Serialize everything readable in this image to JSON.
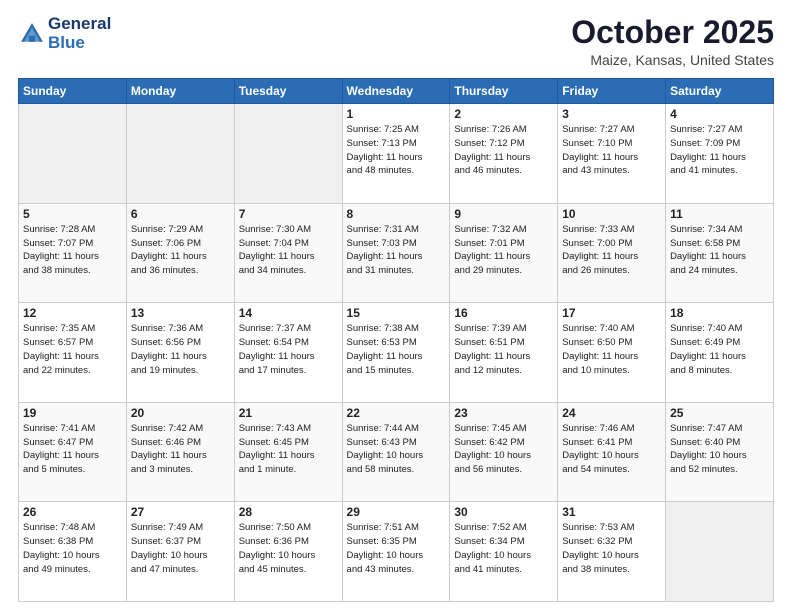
{
  "header": {
    "logo_line1": "General",
    "logo_line2": "Blue",
    "month": "October 2025",
    "location": "Maize, Kansas, United States"
  },
  "days_of_week": [
    "Sunday",
    "Monday",
    "Tuesday",
    "Wednesday",
    "Thursday",
    "Friday",
    "Saturday"
  ],
  "weeks": [
    [
      {
        "day": "",
        "info": ""
      },
      {
        "day": "",
        "info": ""
      },
      {
        "day": "",
        "info": ""
      },
      {
        "day": "1",
        "info": "Sunrise: 7:25 AM\nSunset: 7:13 PM\nDaylight: 11 hours\nand 48 minutes."
      },
      {
        "day": "2",
        "info": "Sunrise: 7:26 AM\nSunset: 7:12 PM\nDaylight: 11 hours\nand 46 minutes."
      },
      {
        "day": "3",
        "info": "Sunrise: 7:27 AM\nSunset: 7:10 PM\nDaylight: 11 hours\nand 43 minutes."
      },
      {
        "day": "4",
        "info": "Sunrise: 7:27 AM\nSunset: 7:09 PM\nDaylight: 11 hours\nand 41 minutes."
      }
    ],
    [
      {
        "day": "5",
        "info": "Sunrise: 7:28 AM\nSunset: 7:07 PM\nDaylight: 11 hours\nand 38 minutes."
      },
      {
        "day": "6",
        "info": "Sunrise: 7:29 AM\nSunset: 7:06 PM\nDaylight: 11 hours\nand 36 minutes."
      },
      {
        "day": "7",
        "info": "Sunrise: 7:30 AM\nSunset: 7:04 PM\nDaylight: 11 hours\nand 34 minutes."
      },
      {
        "day": "8",
        "info": "Sunrise: 7:31 AM\nSunset: 7:03 PM\nDaylight: 11 hours\nand 31 minutes."
      },
      {
        "day": "9",
        "info": "Sunrise: 7:32 AM\nSunset: 7:01 PM\nDaylight: 11 hours\nand 29 minutes."
      },
      {
        "day": "10",
        "info": "Sunrise: 7:33 AM\nSunset: 7:00 PM\nDaylight: 11 hours\nand 26 minutes."
      },
      {
        "day": "11",
        "info": "Sunrise: 7:34 AM\nSunset: 6:58 PM\nDaylight: 11 hours\nand 24 minutes."
      }
    ],
    [
      {
        "day": "12",
        "info": "Sunrise: 7:35 AM\nSunset: 6:57 PM\nDaylight: 11 hours\nand 22 minutes."
      },
      {
        "day": "13",
        "info": "Sunrise: 7:36 AM\nSunset: 6:56 PM\nDaylight: 11 hours\nand 19 minutes."
      },
      {
        "day": "14",
        "info": "Sunrise: 7:37 AM\nSunset: 6:54 PM\nDaylight: 11 hours\nand 17 minutes."
      },
      {
        "day": "15",
        "info": "Sunrise: 7:38 AM\nSunset: 6:53 PM\nDaylight: 11 hours\nand 15 minutes."
      },
      {
        "day": "16",
        "info": "Sunrise: 7:39 AM\nSunset: 6:51 PM\nDaylight: 11 hours\nand 12 minutes."
      },
      {
        "day": "17",
        "info": "Sunrise: 7:40 AM\nSunset: 6:50 PM\nDaylight: 11 hours\nand 10 minutes."
      },
      {
        "day": "18",
        "info": "Sunrise: 7:40 AM\nSunset: 6:49 PM\nDaylight: 11 hours\nand 8 minutes."
      }
    ],
    [
      {
        "day": "19",
        "info": "Sunrise: 7:41 AM\nSunset: 6:47 PM\nDaylight: 11 hours\nand 5 minutes."
      },
      {
        "day": "20",
        "info": "Sunrise: 7:42 AM\nSunset: 6:46 PM\nDaylight: 11 hours\nand 3 minutes."
      },
      {
        "day": "21",
        "info": "Sunrise: 7:43 AM\nSunset: 6:45 PM\nDaylight: 11 hours\nand 1 minute."
      },
      {
        "day": "22",
        "info": "Sunrise: 7:44 AM\nSunset: 6:43 PM\nDaylight: 10 hours\nand 58 minutes."
      },
      {
        "day": "23",
        "info": "Sunrise: 7:45 AM\nSunset: 6:42 PM\nDaylight: 10 hours\nand 56 minutes."
      },
      {
        "day": "24",
        "info": "Sunrise: 7:46 AM\nSunset: 6:41 PM\nDaylight: 10 hours\nand 54 minutes."
      },
      {
        "day": "25",
        "info": "Sunrise: 7:47 AM\nSunset: 6:40 PM\nDaylight: 10 hours\nand 52 minutes."
      }
    ],
    [
      {
        "day": "26",
        "info": "Sunrise: 7:48 AM\nSunset: 6:38 PM\nDaylight: 10 hours\nand 49 minutes."
      },
      {
        "day": "27",
        "info": "Sunrise: 7:49 AM\nSunset: 6:37 PM\nDaylight: 10 hours\nand 47 minutes."
      },
      {
        "day": "28",
        "info": "Sunrise: 7:50 AM\nSunset: 6:36 PM\nDaylight: 10 hours\nand 45 minutes."
      },
      {
        "day": "29",
        "info": "Sunrise: 7:51 AM\nSunset: 6:35 PM\nDaylight: 10 hours\nand 43 minutes."
      },
      {
        "day": "30",
        "info": "Sunrise: 7:52 AM\nSunset: 6:34 PM\nDaylight: 10 hours\nand 41 minutes."
      },
      {
        "day": "31",
        "info": "Sunrise: 7:53 AM\nSunset: 6:32 PM\nDaylight: 10 hours\nand 38 minutes."
      },
      {
        "day": "",
        "info": ""
      }
    ]
  ]
}
